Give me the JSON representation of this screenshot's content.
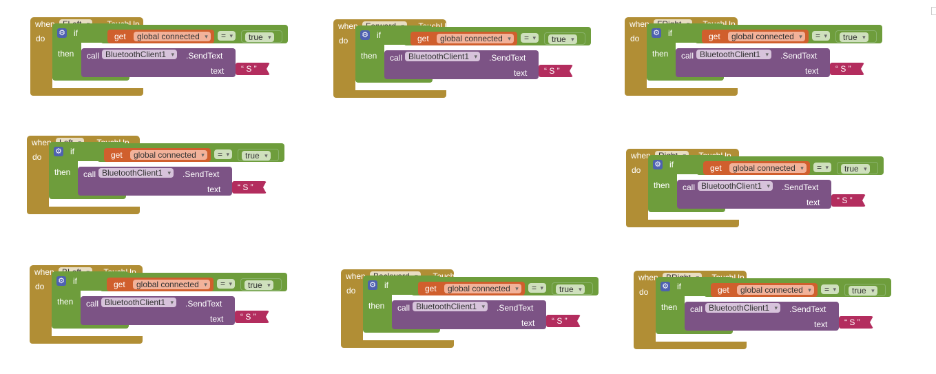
{
  "keywords": {
    "when": "when",
    "do": "do",
    "if": "if",
    "then": "then",
    "call": "call",
    "get": "get",
    "text": "text"
  },
  "shared": {
    "variable": "global connected",
    "operator": "=",
    "boolean": "true",
    "component": "BluetoothClient1",
    "method": ".SendText",
    "string": "“ S ”"
  },
  "blocks": [
    {
      "component": "FLeft",
      "event": ".TouchUp"
    },
    {
      "component": "Forward",
      "event": ".TouchUp"
    },
    {
      "component": "FRight",
      "event": ".TouchUp"
    },
    {
      "component": "Left",
      "event": ".TouchUp"
    },
    {
      "component": "Right",
      "event": ".TouchUp"
    },
    {
      "component": "BLeft",
      "event": ".TouchUp"
    },
    {
      "component": "Backward",
      "event": ".TouchUp"
    },
    {
      "component": "BRight",
      "event": ".TouchUp"
    }
  ],
  "colors": {
    "event_block": "#b18e35",
    "logic_block": "#6e9d3c",
    "procedure_call": "#7c5385",
    "variable_get": "#d05f2d",
    "text_string": "#b32d5e",
    "mutator_gear": "#4e61b0"
  }
}
